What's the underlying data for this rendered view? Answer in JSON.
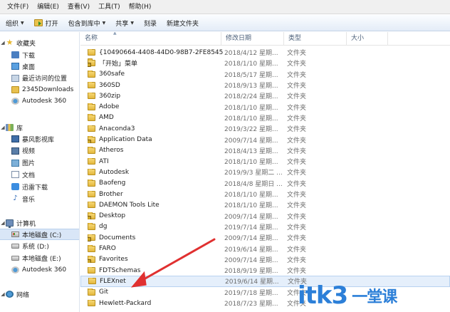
{
  "menu": [
    "文件(F)",
    "编辑(E)",
    "查看(V)",
    "工具(T)",
    "帮助(H)"
  ],
  "toolbar": [
    {
      "label": "组织",
      "caret": true,
      "icon": ""
    },
    {
      "label": "打开",
      "caret": false,
      "icon": "open-icon"
    },
    {
      "label": "包含到库中",
      "caret": true,
      "icon": ""
    },
    {
      "label": "共享",
      "caret": true,
      "icon": ""
    },
    {
      "label": "刻录",
      "caret": false,
      "icon": ""
    },
    {
      "label": "新建文件夹",
      "caret": false,
      "icon": ""
    }
  ],
  "nav": {
    "favorites": {
      "label": "收藏夹",
      "icon": "star-icon"
    },
    "favorite_items": [
      {
        "label": "下载",
        "icon": "download-icon"
      },
      {
        "label": "桌面",
        "icon": "desktop-icon"
      },
      {
        "label": "最近访问的位置",
        "icon": "recent-icon"
      },
      {
        "label": "2345Downloads",
        "icon": "folder-icon"
      },
      {
        "label": "Autodesk 360",
        "icon": "netdrive-icon"
      }
    ],
    "libraries": {
      "label": "库",
      "icon": "library-icon"
    },
    "library_items": [
      {
        "label": "暴风影视库",
        "icon": "video-lib-icon"
      },
      {
        "label": "视频",
        "icon": "video-icon"
      },
      {
        "label": "图片",
        "icon": "picture-icon"
      },
      {
        "label": "文档",
        "icon": "doc-icon"
      },
      {
        "label": "迅雷下载",
        "icon": "xunlei-icon"
      },
      {
        "label": "音乐",
        "icon": "music-icon"
      }
    ],
    "computer": {
      "label": "计算机",
      "icon": "computer-icon"
    },
    "computer_items": [
      {
        "label": "本地磁盘 (C:)",
        "icon": "drive-win-icon",
        "selected": true
      },
      {
        "label": "系统 (D:)",
        "icon": "drive-icon",
        "selected": false
      },
      {
        "label": "本地磁盘 (E:)",
        "icon": "drive-icon",
        "selected": false
      },
      {
        "label": "Autodesk 360",
        "icon": "netdrive-icon",
        "selected": false
      }
    ],
    "network": {
      "label": "网络",
      "icon": "network-icon"
    }
  },
  "columns": {
    "name": "名称",
    "date": "修改日期",
    "type": "类型",
    "size": "大小"
  },
  "files": [
    {
      "name": "{10490664-4408-44D0-98B7-2FE8545...",
      "date": "2018/4/12 星期...",
      "type": "文件夹",
      "lock": false,
      "selected": false
    },
    {
      "name": "「开始」菜单",
      "date": "2018/1/10 星期...",
      "type": "文件夹",
      "lock": true,
      "selected": false
    },
    {
      "name": "360safe",
      "date": "2018/5/17 星期...",
      "type": "文件夹",
      "lock": false,
      "selected": false
    },
    {
      "name": "360SD",
      "date": "2018/9/13 星期...",
      "type": "文件夹",
      "lock": false,
      "selected": false
    },
    {
      "name": "360zip",
      "date": "2018/2/24 星期...",
      "type": "文件夹",
      "lock": false,
      "selected": false
    },
    {
      "name": "Adobe",
      "date": "2018/1/10 星期...",
      "type": "文件夹",
      "lock": false,
      "selected": false
    },
    {
      "name": "AMD",
      "date": "2018/1/10 星期...",
      "type": "文件夹",
      "lock": false,
      "selected": false
    },
    {
      "name": "Anaconda3",
      "date": "2019/3/22 星期...",
      "type": "文件夹",
      "lock": false,
      "selected": false
    },
    {
      "name": "Application Data",
      "date": "2009/7/14 星期...",
      "type": "文件夹",
      "lock": true,
      "selected": false
    },
    {
      "name": "Atheros",
      "date": "2018/4/13 星期...",
      "type": "文件夹",
      "lock": false,
      "selected": false
    },
    {
      "name": "ATI",
      "date": "2018/1/10 星期...",
      "type": "文件夹",
      "lock": false,
      "selected": false
    },
    {
      "name": "Autodesk",
      "date": "2019/9/3 星期二 ...",
      "type": "文件夹",
      "lock": false,
      "selected": false
    },
    {
      "name": "Baofeng",
      "date": "2018/4/8 星期日 ...",
      "type": "文件夹",
      "lock": false,
      "selected": false
    },
    {
      "name": "Brother",
      "date": "2018/1/10 星期...",
      "type": "文件夹",
      "lock": false,
      "selected": false
    },
    {
      "name": "DAEMON Tools Lite",
      "date": "2018/1/10 星期...",
      "type": "文件夹",
      "lock": false,
      "selected": false
    },
    {
      "name": "Desktop",
      "date": "2009/7/14 星期...",
      "type": "文件夹",
      "lock": true,
      "selected": false
    },
    {
      "name": "dg",
      "date": "2019/7/14 星期...",
      "type": "文件夹",
      "lock": false,
      "selected": false
    },
    {
      "name": "Documents",
      "date": "2009/7/14 星期...",
      "type": "文件夹",
      "lock": true,
      "selected": false
    },
    {
      "name": "FARO",
      "date": "2019/6/14 星期...",
      "type": "文件夹",
      "lock": false,
      "selected": false
    },
    {
      "name": "Favorites",
      "date": "2009/7/14 星期...",
      "type": "文件夹",
      "lock": true,
      "selected": false
    },
    {
      "name": "FDTSchemas",
      "date": "2018/9/19 星期...",
      "type": "文件夹",
      "lock": false,
      "selected": false
    },
    {
      "name": "FLEXnet",
      "date": "2019/6/14 星期...",
      "type": "文件夹",
      "lock": false,
      "selected": true
    },
    {
      "name": "Git",
      "date": "2019/7/18 星期...",
      "type": "文件夹",
      "lock": false,
      "selected": false
    },
    {
      "name": "Hewlett-Packard",
      "date": "2018/7/23 星期...",
      "type": "文件夹",
      "lock": false,
      "selected": false
    }
  ],
  "watermark": {
    "text": "itk3",
    "cn": "一堂课"
  },
  "colors": {
    "arrow": "#e03030",
    "selection": "#e5effb",
    "watermark": "#2c7fd8"
  }
}
